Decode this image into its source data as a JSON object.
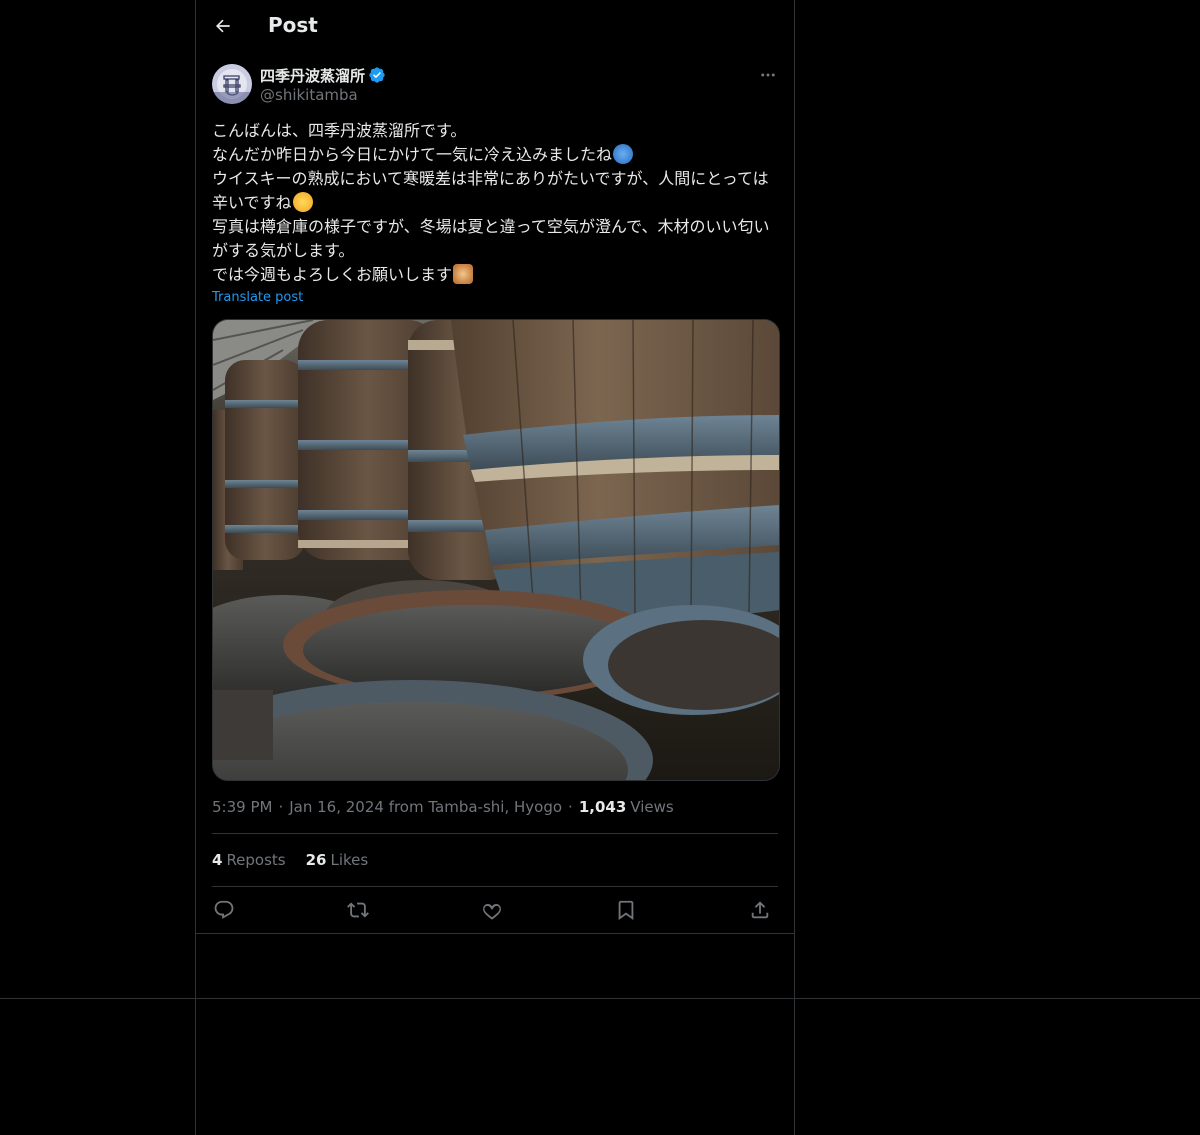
{
  "header": {
    "title": "Post",
    "back_icon": "arrow-left-icon"
  },
  "author": {
    "name": "四季丹波蒸溜所",
    "handle": "@shikitamba",
    "verified": true,
    "verified_color": "#1d9bf0",
    "avatar_text": "丹波"
  },
  "post": {
    "lines": [
      "こんばんは、四季丹波蒸溜所です。",
      "なんだか昨日から今日にかけて一気に冷え込みましたね",
      "ウイスキーの熟成において寒暖差は非常にありがたいですが、人間にとっては辛いですね",
      "写真は樽倉庫の様子ですが、冬場は夏と違って空気が澄んで、木材のいい匂いがする気がします。",
      "では今週もよろしくお願いします"
    ],
    "emojis": [
      "cold-face-emoji",
      "sweat-smile-emoji",
      "person-bowing-emoji"
    ],
    "translate_label": "Translate post",
    "media_description_icon": "photo-whisky-barrels"
  },
  "meta": {
    "time": "5:39 PM",
    "separator": "·",
    "date_location": "Jan 16, 2024 from Tamba-shi, Hyogo",
    "views_count": "1,043",
    "views_label": "Views"
  },
  "stats": {
    "reposts_count": "4",
    "reposts_label": "Reposts",
    "likes_count": "26",
    "likes_label": "Likes"
  },
  "actions": {
    "reply_icon": "reply-icon",
    "repost_icon": "repost-icon",
    "like_icon": "heart-icon",
    "bookmark_icon": "bookmark-icon",
    "share_icon": "share-icon"
  },
  "colors": {
    "background": "#000000",
    "text": "#e7e9ea",
    "muted": "#71767b",
    "border": "#2f3336",
    "accent": "#1d9bf0"
  }
}
